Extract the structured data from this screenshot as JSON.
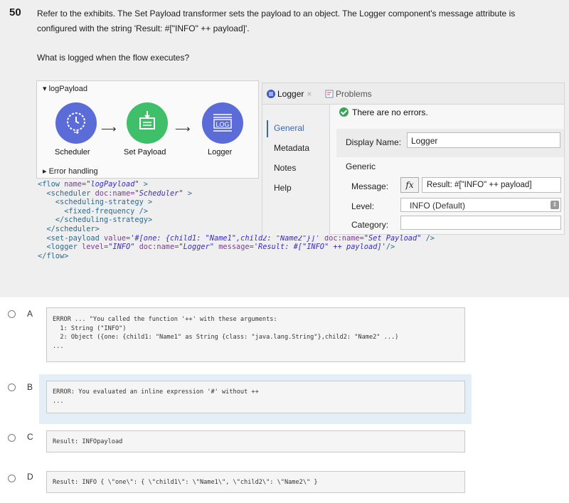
{
  "question": {
    "number": "50",
    "line1": "Refer to the exhibits. The Set Payload transformer sets the payload to an object. The Logger component's message attribute is",
    "line2": "configured with the string 'Result: #[\"INFO\" ++ payload]'.",
    "ask": "What is logged when the flow executes?"
  },
  "flow": {
    "title": "logPayload",
    "nodes": [
      {
        "label": "Scheduler",
        "icon": "clock-icon",
        "color": "#5b6bd8"
      },
      {
        "label": "Set Payload",
        "icon": "set-payload-icon",
        "color": "#3fbf6a"
      },
      {
        "label": "Logger",
        "icon": "log-icon",
        "icon_text": "LOG",
        "color": "#5b6bd8"
      }
    ],
    "error_handling": "Error handling"
  },
  "xml": {
    "l1a": "<flow ",
    "l1b": "name=",
    "l1c": "\"logPayload\"",
    "l1d": " >",
    "l2a": "  <scheduler ",
    "l2b": "doc:name=",
    "l2c": "\"Scheduler\"",
    "l2d": " >",
    "l3": "    <scheduling-strategy >",
    "l4": "      <fixed-frequency />",
    "l5": "    </scheduling-strategy>",
    "l6": "  </scheduler>",
    "l7a": "  <set-payload ",
    "l7b": "value=",
    "l7c": "'#[one: {child1: \"Name1\",child2: \"Name2\"}]'",
    "l7d": " doc:name=",
    "l7e": "\"Set Payload\"",
    "l7f": " />",
    "l8a": "  <logger ",
    "l8b": "level=",
    "l8c": "\"INFO\"",
    "l8d": " doc:name=",
    "l8e": "\"Logger\"",
    "l8f": " message=",
    "l8g": "'Result: #[\"INFO\" ++ payload]'",
    "l8h": "/>",
    "l9": "</flow>"
  },
  "props": {
    "tab_logger": "Logger",
    "tab_close": "×",
    "tab_problems": "Problems",
    "no_errors": "There are no errors.",
    "sidebar": [
      "General",
      "Metadata",
      "Notes",
      "Help"
    ],
    "display_name_label": "Display Name:",
    "display_name_value": "Logger",
    "generic_label": "Generic",
    "message_label": "Message:",
    "fx_label": "fx",
    "message_value": "Result: #[\"INFO\" ++ payload]",
    "level_label": "Level:",
    "level_value": "INFO (Default)",
    "category_label": "Category:"
  },
  "options": [
    {
      "letter": "A",
      "lines": [
        "ERROR ... \"You called the function '++' with these arguments:",
        "  1: String (\"INFO\")",
        "  2: Object ({one: {child1: \"Name1\" as String {class: \"java.lang.String\"},child2: \"Name2\" ...)",
        "..."
      ]
    },
    {
      "letter": "B",
      "lines": [
        "ERROR: You evaluated an inline expression '#' without ++",
        "..."
      ]
    },
    {
      "letter": "C",
      "lines": [
        "Result: INFOpayload"
      ]
    },
    {
      "letter": "D",
      "lines": [
        "Result: INFO { \\\"one\\\": { \\\"child1\\\": \\\"Name1\\\", \\\"child2\\\": \\\"Name2\\\" }"
      ]
    }
  ]
}
